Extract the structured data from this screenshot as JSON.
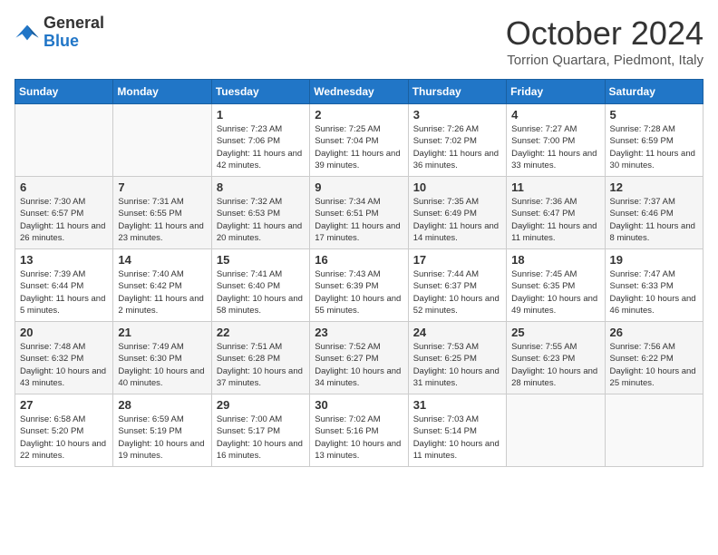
{
  "header": {
    "logo_line1": "General",
    "logo_line2": "Blue",
    "month": "October 2024",
    "location": "Torrion Quartara, Piedmont, Italy"
  },
  "days_of_week": [
    "Sunday",
    "Monday",
    "Tuesday",
    "Wednesday",
    "Thursday",
    "Friday",
    "Saturday"
  ],
  "weeks": [
    [
      {
        "day": "",
        "info": ""
      },
      {
        "day": "",
        "info": ""
      },
      {
        "day": "1",
        "info": "Sunrise: 7:23 AM\nSunset: 7:06 PM\nDaylight: 11 hours and 42 minutes."
      },
      {
        "day": "2",
        "info": "Sunrise: 7:25 AM\nSunset: 7:04 PM\nDaylight: 11 hours and 39 minutes."
      },
      {
        "day": "3",
        "info": "Sunrise: 7:26 AM\nSunset: 7:02 PM\nDaylight: 11 hours and 36 minutes."
      },
      {
        "day": "4",
        "info": "Sunrise: 7:27 AM\nSunset: 7:00 PM\nDaylight: 11 hours and 33 minutes."
      },
      {
        "day": "5",
        "info": "Sunrise: 7:28 AM\nSunset: 6:59 PM\nDaylight: 11 hours and 30 minutes."
      }
    ],
    [
      {
        "day": "6",
        "info": "Sunrise: 7:30 AM\nSunset: 6:57 PM\nDaylight: 11 hours and 26 minutes."
      },
      {
        "day": "7",
        "info": "Sunrise: 7:31 AM\nSunset: 6:55 PM\nDaylight: 11 hours and 23 minutes."
      },
      {
        "day": "8",
        "info": "Sunrise: 7:32 AM\nSunset: 6:53 PM\nDaylight: 11 hours and 20 minutes."
      },
      {
        "day": "9",
        "info": "Sunrise: 7:34 AM\nSunset: 6:51 PM\nDaylight: 11 hours and 17 minutes."
      },
      {
        "day": "10",
        "info": "Sunrise: 7:35 AM\nSunset: 6:49 PM\nDaylight: 11 hours and 14 minutes."
      },
      {
        "day": "11",
        "info": "Sunrise: 7:36 AM\nSunset: 6:47 PM\nDaylight: 11 hours and 11 minutes."
      },
      {
        "day": "12",
        "info": "Sunrise: 7:37 AM\nSunset: 6:46 PM\nDaylight: 11 hours and 8 minutes."
      }
    ],
    [
      {
        "day": "13",
        "info": "Sunrise: 7:39 AM\nSunset: 6:44 PM\nDaylight: 11 hours and 5 minutes."
      },
      {
        "day": "14",
        "info": "Sunrise: 7:40 AM\nSunset: 6:42 PM\nDaylight: 11 hours and 2 minutes."
      },
      {
        "day": "15",
        "info": "Sunrise: 7:41 AM\nSunset: 6:40 PM\nDaylight: 10 hours and 58 minutes."
      },
      {
        "day": "16",
        "info": "Sunrise: 7:43 AM\nSunset: 6:39 PM\nDaylight: 10 hours and 55 minutes."
      },
      {
        "day": "17",
        "info": "Sunrise: 7:44 AM\nSunset: 6:37 PM\nDaylight: 10 hours and 52 minutes."
      },
      {
        "day": "18",
        "info": "Sunrise: 7:45 AM\nSunset: 6:35 PM\nDaylight: 10 hours and 49 minutes."
      },
      {
        "day": "19",
        "info": "Sunrise: 7:47 AM\nSunset: 6:33 PM\nDaylight: 10 hours and 46 minutes."
      }
    ],
    [
      {
        "day": "20",
        "info": "Sunrise: 7:48 AM\nSunset: 6:32 PM\nDaylight: 10 hours and 43 minutes."
      },
      {
        "day": "21",
        "info": "Sunrise: 7:49 AM\nSunset: 6:30 PM\nDaylight: 10 hours and 40 minutes."
      },
      {
        "day": "22",
        "info": "Sunrise: 7:51 AM\nSunset: 6:28 PM\nDaylight: 10 hours and 37 minutes."
      },
      {
        "day": "23",
        "info": "Sunrise: 7:52 AM\nSunset: 6:27 PM\nDaylight: 10 hours and 34 minutes."
      },
      {
        "day": "24",
        "info": "Sunrise: 7:53 AM\nSunset: 6:25 PM\nDaylight: 10 hours and 31 minutes."
      },
      {
        "day": "25",
        "info": "Sunrise: 7:55 AM\nSunset: 6:23 PM\nDaylight: 10 hours and 28 minutes."
      },
      {
        "day": "26",
        "info": "Sunrise: 7:56 AM\nSunset: 6:22 PM\nDaylight: 10 hours and 25 minutes."
      }
    ],
    [
      {
        "day": "27",
        "info": "Sunrise: 6:58 AM\nSunset: 5:20 PM\nDaylight: 10 hours and 22 minutes."
      },
      {
        "day": "28",
        "info": "Sunrise: 6:59 AM\nSunset: 5:19 PM\nDaylight: 10 hours and 19 minutes."
      },
      {
        "day": "29",
        "info": "Sunrise: 7:00 AM\nSunset: 5:17 PM\nDaylight: 10 hours and 16 minutes."
      },
      {
        "day": "30",
        "info": "Sunrise: 7:02 AM\nSunset: 5:16 PM\nDaylight: 10 hours and 13 minutes."
      },
      {
        "day": "31",
        "info": "Sunrise: 7:03 AM\nSunset: 5:14 PM\nDaylight: 10 hours and 11 minutes."
      },
      {
        "day": "",
        "info": ""
      },
      {
        "day": "",
        "info": ""
      }
    ]
  ]
}
